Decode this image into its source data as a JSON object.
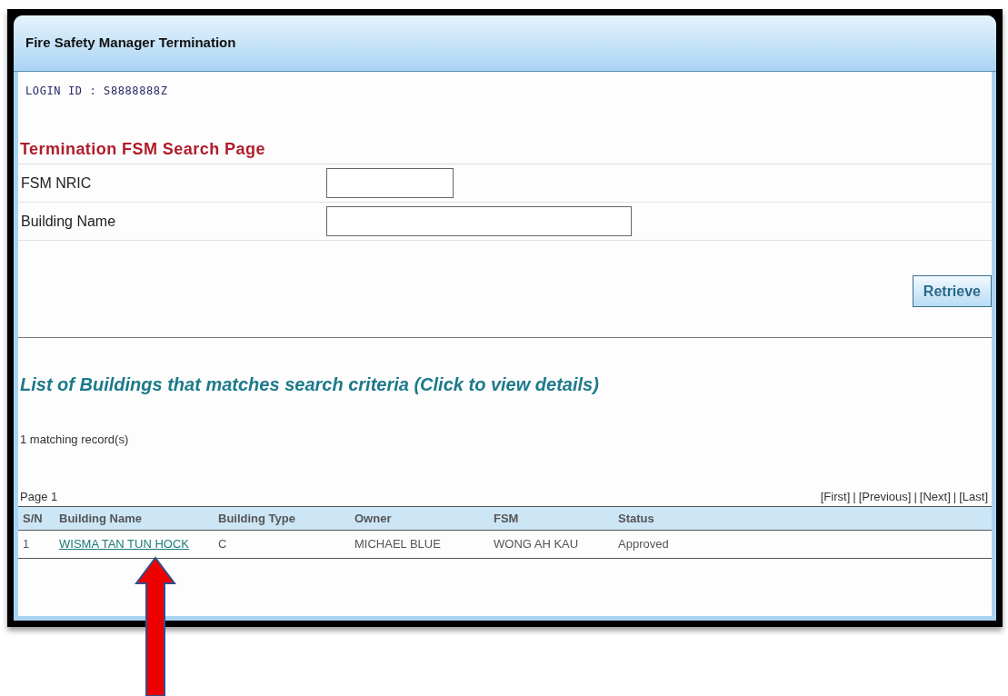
{
  "window": {
    "title": "Fire Safety Manager Termination"
  },
  "login_id": "LOGIN ID : S8888888Z",
  "search": {
    "heading": "Termination FSM Search Page",
    "fields": [
      {
        "label": "FSM NRIC"
      },
      {
        "label": "Building Name"
      }
    ],
    "button": "Retrieve"
  },
  "results": {
    "heading": "List of Buildings that matches search criteria (Click to view details)",
    "count": "1 matching record(s)",
    "page": "Page 1",
    "pager": [
      "[First]",
      "[Previous]",
      "[Next]",
      "[Last]"
    ],
    "pager_separator": "|",
    "columns": [
      "S/N",
      "Building Name",
      "Building Type",
      "Owner",
      "FSM",
      "Status"
    ],
    "rows": [
      [
        "1",
        "WISMA TAN TUN HOCK",
        "C",
        "MICHAEL BLUE",
        "WONG AH KAU",
        "Approved"
      ]
    ]
  }
}
